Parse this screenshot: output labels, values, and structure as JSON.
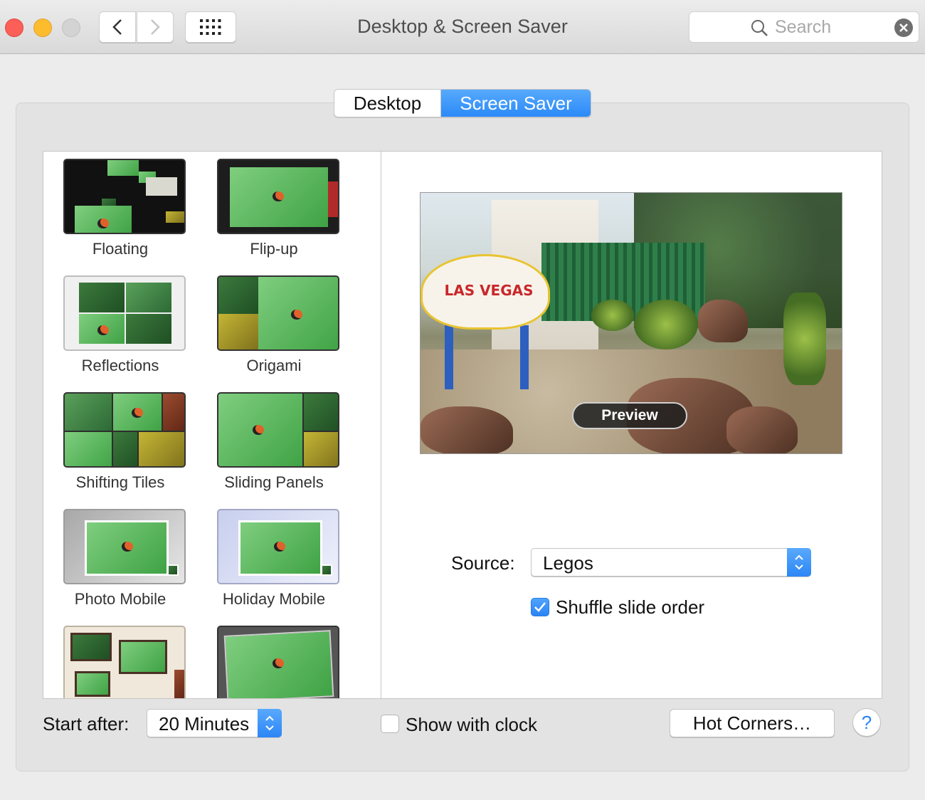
{
  "window": {
    "title": "Desktop & Screen Saver"
  },
  "search": {
    "placeholder": "Search"
  },
  "tabs": [
    {
      "label": "Desktop",
      "selected": false
    },
    {
      "label": "Screen Saver",
      "selected": true
    }
  ],
  "savers": [
    {
      "label": "Floating"
    },
    {
      "label": "Flip-up"
    },
    {
      "label": "Reflections"
    },
    {
      "label": "Origami"
    },
    {
      "label": "Shifting Tiles"
    },
    {
      "label": "Sliding Panels"
    },
    {
      "label": "Photo Mobile"
    },
    {
      "label": "Holiday Mobile"
    },
    {
      "label": ""
    },
    {
      "label": ""
    }
  ],
  "preview": {
    "button_label": "Preview",
    "sign_text": "LAS VEGAS"
  },
  "source": {
    "label": "Source:",
    "value": "Legos"
  },
  "shuffle": {
    "label": "Shuffle slide order",
    "checked": true
  },
  "start_after": {
    "label": "Start after:",
    "value": "20 Minutes"
  },
  "show_clock": {
    "label": "Show with clock",
    "checked": false
  },
  "hot_corners": {
    "label": "Hot Corners…"
  },
  "help": {
    "label": "?"
  },
  "colors": {
    "accent": "#2c8af8",
    "close": "#fc5f57",
    "minimize": "#fdbc2e"
  }
}
